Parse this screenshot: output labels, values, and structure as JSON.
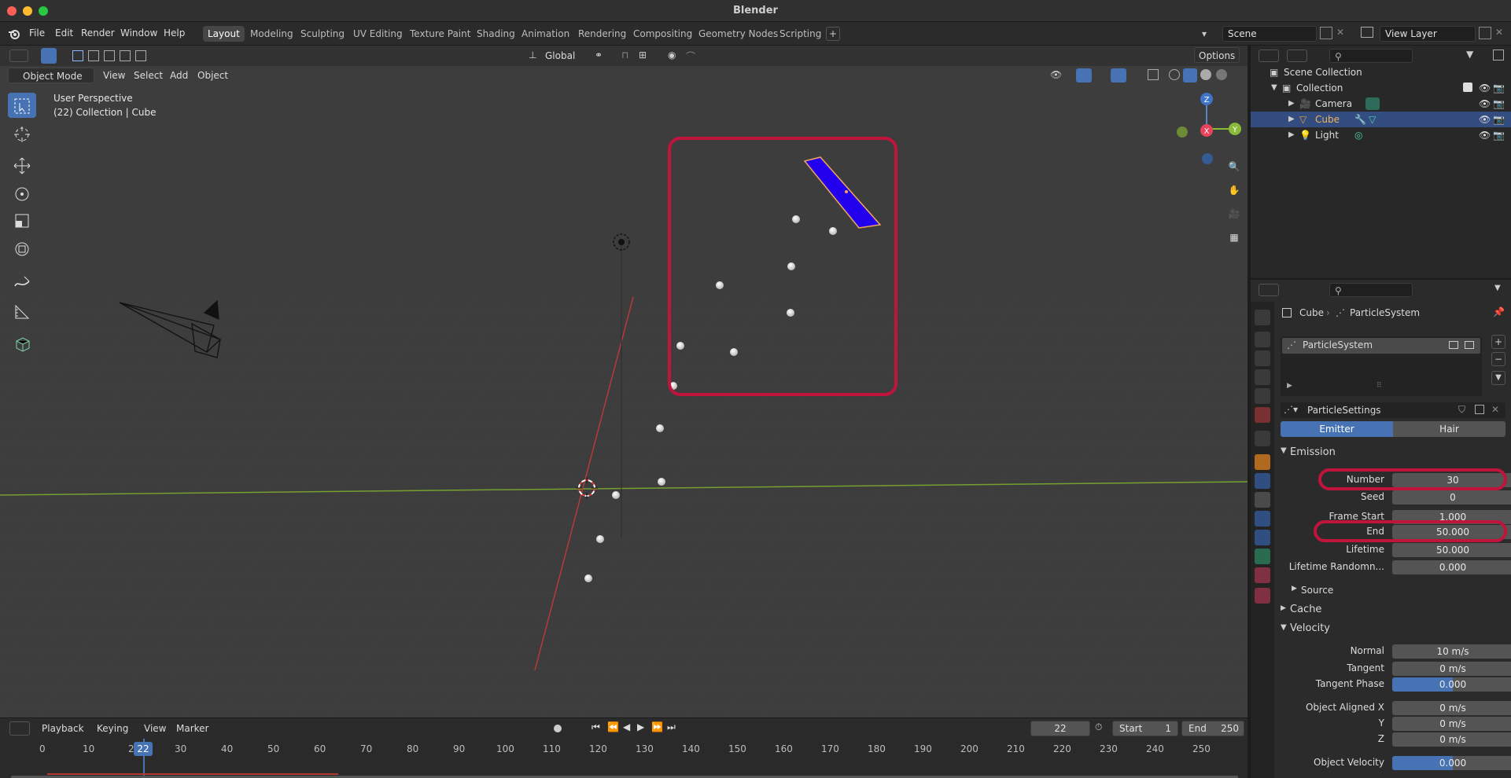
{
  "window": {
    "title": "Blender"
  },
  "menu": {
    "items": [
      "File",
      "Edit",
      "Render",
      "Window",
      "Help"
    ]
  },
  "workspaces": [
    "Layout",
    "Modeling",
    "Sculpting",
    "UV Editing",
    "Texture Paint",
    "Shading",
    "Animation",
    "Rendering",
    "Compositing",
    "Geometry Nodes",
    "Scripting"
  ],
  "scene": {
    "name": "Scene",
    "view_layer": "View Layer"
  },
  "viewport": {
    "mode": "Object Mode",
    "menus": [
      "View",
      "Select",
      "Add",
      "Object"
    ],
    "orientation": "Global",
    "options_label": "Options",
    "info_line1": "User Perspective",
    "info_line2": "(22) Collection | Cube",
    "gizmo": {
      "z": "Z",
      "x": "X",
      "y": "Y"
    }
  },
  "timeline": {
    "menus": [
      "Playback",
      "Keying",
      "View",
      "Marker"
    ],
    "current_frame": "22",
    "start_label": "Start",
    "start_value": "1",
    "end_label": "End",
    "end_value": "250",
    "ticks": [
      "0",
      "10",
      "2",
      "30",
      "40",
      "50",
      "60",
      "70",
      "80",
      "90",
      "100",
      "110",
      "120",
      "130",
      "140",
      "150",
      "160",
      "170",
      "180",
      "190",
      "200",
      "210",
      "220",
      "230",
      "240",
      "250"
    ],
    "playhead": "22"
  },
  "outliner": {
    "root": "Scene Collection",
    "collection": "Collection",
    "items": [
      {
        "name": "Camera",
        "selected": false
      },
      {
        "name": "Cube",
        "selected": true
      },
      {
        "name": "Light",
        "selected": false
      }
    ]
  },
  "properties": {
    "breadcrumb_object": "Cube",
    "breadcrumb_system": "ParticleSystem",
    "system_list_item": "ParticleSystem",
    "settings_name": "ParticleSettings",
    "type_emitter": "Emitter",
    "type_hair": "Hair",
    "emission_header": "Emission",
    "fields": [
      {
        "label": "Number",
        "value": "30"
      },
      {
        "label": "Seed",
        "value": "0"
      },
      {
        "label": "Frame Start",
        "value": "1.000"
      },
      {
        "label": "End",
        "value": "50.000"
      },
      {
        "label": "Lifetime",
        "value": "50.000"
      },
      {
        "label": "Lifetime Randomn...",
        "value": "0.000"
      }
    ],
    "source_header": "Source",
    "cache_header": "Cache",
    "velocity_header": "Velocity",
    "velocity_fields": [
      {
        "label": "Normal",
        "value": "10 m/s"
      },
      {
        "label": "Tangent",
        "value": "0 m/s"
      },
      {
        "label": "Tangent Phase",
        "value": "0.000"
      },
      {
        "label": "Object Aligned X",
        "value": "0 m/s"
      },
      {
        "label": "Y",
        "value": "0 m/s"
      },
      {
        "label": "Z",
        "value": "0 m/s"
      },
      {
        "label": "Object Velocity",
        "value": "0.000"
      }
    ]
  },
  "colors": {
    "accent": "#4772b3",
    "highlight": "#c0143c",
    "plane": "#2200ee"
  }
}
